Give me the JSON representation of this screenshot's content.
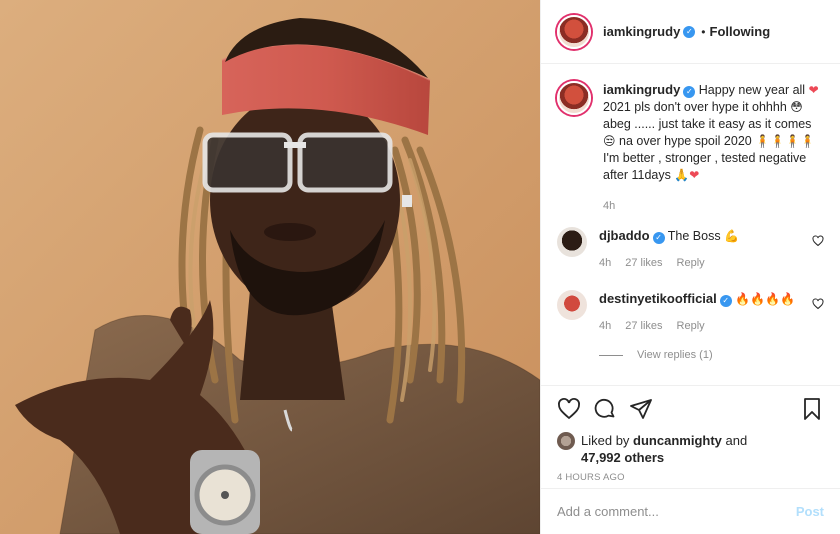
{
  "post": {
    "author": "iamkingrudy",
    "following_label": "Following",
    "separator": "•",
    "caption_parts": [
      "Happy new year all ",
      " 2021 pls don't over hype it ohhhh ",
      " abeg ...... just take it easy as it comes ",
      " na over hype spoil 2020 ",
      " I'm better , stronger , tested negative after 11days "
    ],
    "caption_time": "4h",
    "emojis": {
      "heart": "❤",
      "flushed": "😳",
      "unamused": "😒",
      "persons": "🧍🧍🧍🧍",
      "pray": "🙏",
      "muscle": "💪",
      "fire": "🔥🔥🔥🔥"
    }
  },
  "comments": [
    {
      "user": "djbaddo",
      "text": "The Boss ",
      "time": "4h",
      "likes": "27 likes",
      "reply": "Reply"
    },
    {
      "user": "destinyetikoofficial",
      "text": "",
      "time": "4h",
      "likes": "27 likes",
      "reply": "Reply"
    }
  ],
  "view_replies": "View replies (1)",
  "likes": {
    "prefix": "Liked by ",
    "user": "duncanmighty",
    "middle": " and",
    "count": "47,992 others"
  },
  "post_time": "4 HOURS AGO",
  "comment_box": {
    "placeholder": "Add a comment...",
    "post_label": "Post"
  },
  "colors": {
    "verified": "#3897f0",
    "story_ring": "#e1306c",
    "post_disabled": "#b2dffc",
    "heart": "#ed4956"
  }
}
